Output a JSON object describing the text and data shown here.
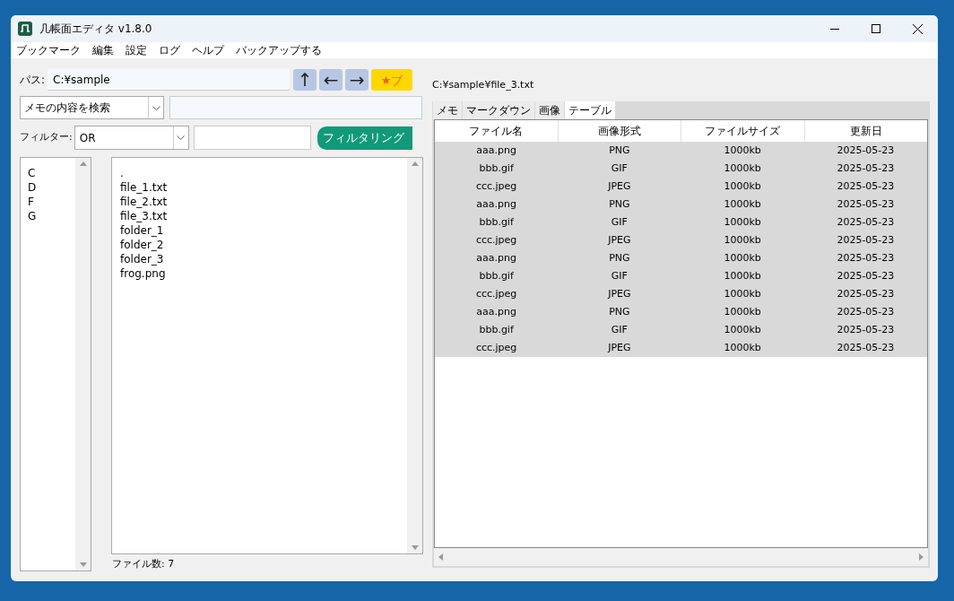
{
  "window": {
    "title": "几帳面エディタ v1.8.0"
  },
  "menu": [
    "ブックマーク",
    "編集",
    "設定",
    "ログ",
    "ヘルプ",
    "バックアップする"
  ],
  "path": {
    "label": "パス:",
    "value": "C:¥sample"
  },
  "nav_buttons": [
    {
      "kind": "up",
      "label": "↑"
    },
    {
      "kind": "back",
      "label": "←"
    },
    {
      "kind": "forward",
      "label": "→"
    },
    {
      "kind": "bookmark",
      "label": "★ブ"
    }
  ],
  "search": {
    "mode": "メモの内容を検索"
  },
  "filter": {
    "label": "フィルター:",
    "mode": "OR",
    "button": "フィルタリング"
  },
  "drives": [
    "C",
    "D",
    "F",
    "G"
  ],
  "files": [
    ".",
    "file_1.txt",
    "file_2.txt",
    "file_3.txt",
    "folder_1",
    "folder_2",
    "folder_3",
    "frog.png"
  ],
  "file_count": "ファイル数: 7",
  "current_file": "C:¥sample¥file_3.txt",
  "tabs": [
    {
      "label": "メモ",
      "selected": false
    },
    {
      "label": "マークダウン",
      "selected": false
    },
    {
      "label": "画像",
      "selected": false
    },
    {
      "label": "テーブル",
      "selected": true
    }
  ],
  "table": {
    "columns": [
      "ファイル名",
      "画像形式",
      "ファイルサイズ",
      "更新日"
    ],
    "rows": [
      [
        "aaa.png",
        "PNG",
        "1000kb",
        "2025-05-23"
      ],
      [
        "bbb.gif",
        "GIF",
        "1000kb",
        "2025-05-23"
      ],
      [
        "ccc.jpeg",
        "JPEG",
        "1000kb",
        "2025-05-23"
      ],
      [
        "aaa.png",
        "PNG",
        "1000kb",
        "2025-05-23"
      ],
      [
        "bbb.gif",
        "GIF",
        "1000kb",
        "2025-05-23"
      ],
      [
        "ccc.jpeg",
        "JPEG",
        "1000kb",
        "2025-05-23"
      ],
      [
        "aaa.png",
        "PNG",
        "1000kb",
        "2025-05-23"
      ],
      [
        "bbb.gif",
        "GIF",
        "1000kb",
        "2025-05-23"
      ],
      [
        "ccc.jpeg",
        "JPEG",
        "1000kb",
        "2025-05-23"
      ],
      [
        "aaa.png",
        "PNG",
        "1000kb",
        "2025-05-23"
      ],
      [
        "bbb.gif",
        "GIF",
        "1000kb",
        "2025-05-23"
      ],
      [
        "ccc.jpeg",
        "JPEG",
        "1000kb",
        "2025-05-23"
      ]
    ]
  }
}
